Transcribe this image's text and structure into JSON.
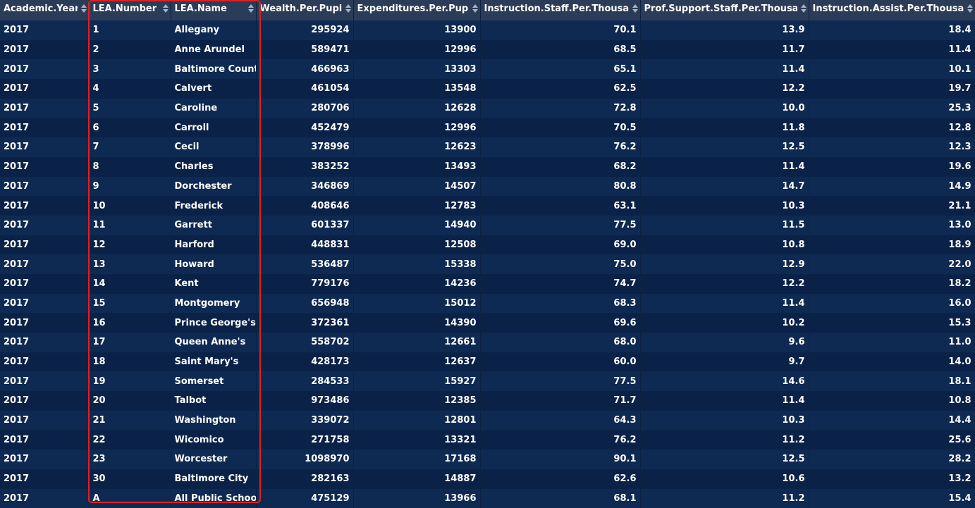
{
  "columns": [
    {
      "label": "Academic.Year",
      "align": "left"
    },
    {
      "label": "LEA.Number",
      "align": "left"
    },
    {
      "label": "LEA.Name",
      "align": "left"
    },
    {
      "label": "Wealth.Per.Pupil",
      "align": "right"
    },
    {
      "label": "Expenditures.Per.Pupil",
      "align": "right"
    },
    {
      "label": "Instruction.Staff.Per.Thousand",
      "align": "right"
    },
    {
      "label": "Prof.Support.Staff.Per.Thousand",
      "align": "right"
    },
    {
      "label": "Instruction.Assist.Per.Thousand",
      "align": "right"
    }
  ],
  "rows": [
    [
      "2017",
      "1",
      "Allegany",
      "295924",
      "13900",
      "70.1",
      "13.9",
      "18.4"
    ],
    [
      "2017",
      "2",
      "Anne Arundel",
      "589471",
      "12996",
      "68.5",
      "11.7",
      "11.4"
    ],
    [
      "2017",
      "3",
      "Baltimore County",
      "466963",
      "13303",
      "65.1",
      "11.4",
      "10.1"
    ],
    [
      "2017",
      "4",
      "Calvert",
      "461054",
      "13548",
      "62.5",
      "12.2",
      "19.7"
    ],
    [
      "2017",
      "5",
      "Caroline",
      "280706",
      "12628",
      "72.8",
      "10.0",
      "25.3"
    ],
    [
      "2017",
      "6",
      "Carroll",
      "452479",
      "12996",
      "70.5",
      "11.8",
      "12.8"
    ],
    [
      "2017",
      "7",
      "Cecil",
      "378996",
      "12623",
      "76.2",
      "12.5",
      "12.3"
    ],
    [
      "2017",
      "8",
      "Charles",
      "383252",
      "13493",
      "68.2",
      "11.4",
      "19.6"
    ],
    [
      "2017",
      "9",
      "Dorchester",
      "346869",
      "14507",
      "80.8",
      "14.7",
      "14.9"
    ],
    [
      "2017",
      "10",
      "Frederick",
      "408646",
      "12783",
      "63.1",
      "10.3",
      "21.1"
    ],
    [
      "2017",
      "11",
      "Garrett",
      "601337",
      "14940",
      "77.5",
      "11.5",
      "13.0"
    ],
    [
      "2017",
      "12",
      "Harford",
      "448831",
      "12508",
      "69.0",
      "10.8",
      "18.9"
    ],
    [
      "2017",
      "13",
      "Howard",
      "536487",
      "15338",
      "75.0",
      "12.9",
      "22.0"
    ],
    [
      "2017",
      "14",
      "Kent",
      "779176",
      "14236",
      "74.7",
      "12.2",
      "18.2"
    ],
    [
      "2017",
      "15",
      "Montgomery",
      "656948",
      "15012",
      "68.3",
      "11.4",
      "16.0"
    ],
    [
      "2017",
      "16",
      "Prince George's",
      "372361",
      "14390",
      "69.6",
      "10.2",
      "15.3"
    ],
    [
      "2017",
      "17",
      "Queen Anne's",
      "558702",
      "12661",
      "68.0",
      "9.6",
      "11.0"
    ],
    [
      "2017",
      "18",
      "Saint Mary's",
      "428173",
      "12637",
      "60.0",
      "9.7",
      "14.0"
    ],
    [
      "2017",
      "19",
      "Somerset",
      "284533",
      "15927",
      "77.5",
      "14.6",
      "18.1"
    ],
    [
      "2017",
      "20",
      "Talbot",
      "973486",
      "12385",
      "71.7",
      "11.4",
      "10.8"
    ],
    [
      "2017",
      "21",
      "Washington",
      "339072",
      "12801",
      "64.3",
      "10.3",
      "14.4"
    ],
    [
      "2017",
      "22",
      "Wicomico",
      "271758",
      "13321",
      "76.2",
      "11.2",
      "25.6"
    ],
    [
      "2017",
      "23",
      "Worcester",
      "1098970",
      "17168",
      "90.1",
      "12.5",
      "28.2"
    ],
    [
      "2017",
      "30",
      "Baltimore City",
      "282163",
      "14887",
      "62.6",
      "10.6",
      "13.2"
    ],
    [
      "2017",
      "A",
      "All Public Schools",
      "475129",
      "13966",
      "68.1",
      "11.2",
      "15.4"
    ]
  ],
  "colors": {
    "background": "#0d2142",
    "header": "#2b3c58",
    "highlight": "#e02020"
  }
}
